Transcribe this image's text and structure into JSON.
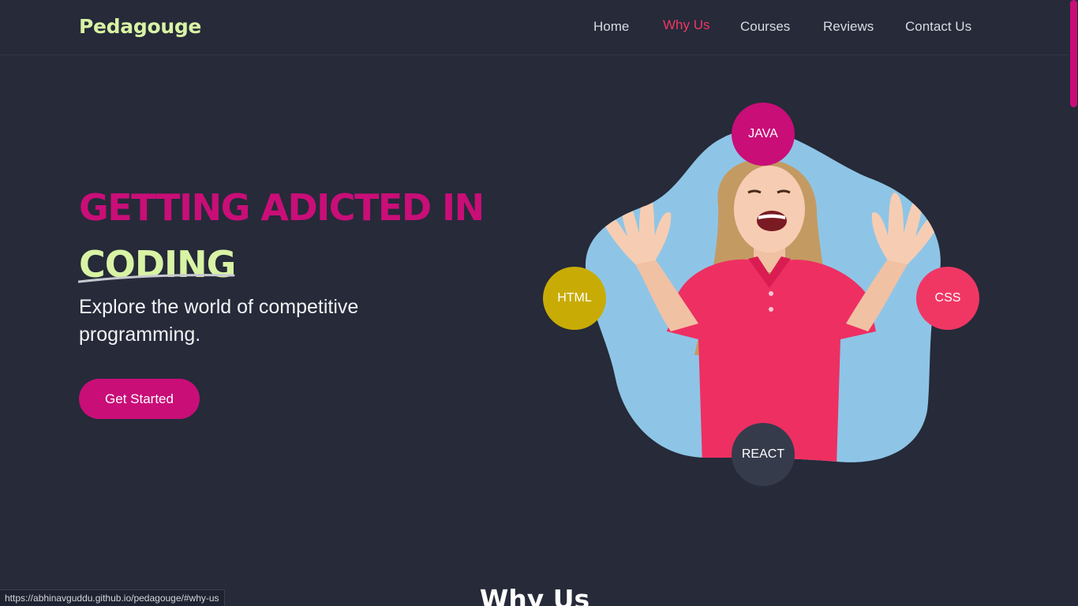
{
  "header": {
    "logo": "Pedagouge",
    "nav": [
      {
        "label": "Home"
      },
      {
        "label": "Why Us"
      },
      {
        "label": "Courses"
      },
      {
        "label": "Reviews"
      },
      {
        "label": "Contact Us"
      }
    ],
    "active_color": "#f03764"
  },
  "hero": {
    "title_line1": "GETTING ADICTED IN",
    "title_line2": "CODING",
    "subtitle": "Explore the world of competitive programming.",
    "cta_label": "Get Started"
  },
  "visual": {
    "badges": [
      {
        "label": "JAVA",
        "color": "#c90e78"
      },
      {
        "label": "HTML",
        "color": "#c8ac05"
      },
      {
        "label": "CSS",
        "color": "#f03764"
      },
      {
        "label": "REACT",
        "color": "#363b4c"
      }
    ],
    "image": "smiling-woman-pink-polo"
  },
  "next_section": {
    "heading": "Why Us"
  },
  "status_bar": {
    "url": "https://abhinavguddu.github.io/pedagouge/#why-us"
  },
  "colors": {
    "background": "#262a39",
    "accent": "#c90e78",
    "logo": "#d8f3a4",
    "blob": "#8ec5e6"
  }
}
